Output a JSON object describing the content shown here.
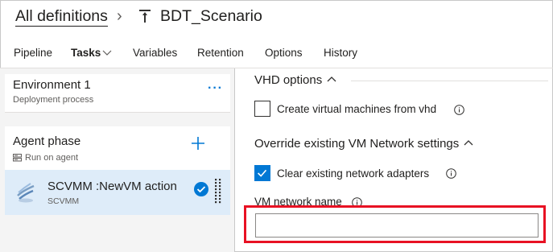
{
  "header": {
    "breadcrumb_link": "All definitions",
    "breadcrumb_separator": "›",
    "definition_icon": "rocket-pipeline-icon",
    "definition_name": "BDT_Scenario"
  },
  "tabs": [
    {
      "label": "Pipeline"
    },
    {
      "label": "Tasks",
      "active": true
    },
    {
      "label": "Variables"
    },
    {
      "label": "Retention"
    },
    {
      "label": "Options"
    },
    {
      "label": "History"
    }
  ],
  "left_pane": {
    "environment": {
      "title": "Environment 1",
      "subtitle": "Deployment process",
      "more": "···"
    },
    "phase": {
      "title": "Agent phase",
      "subtitle": "Run on agent",
      "add_icon": "plus-icon"
    },
    "task": {
      "title": "SCVMM :NewVM action",
      "subtitle": "SCVMM",
      "icon": "scvmm-icon"
    }
  },
  "right_pane": {
    "vhd_section": {
      "title": "VHD options"
    },
    "vhd_checkbox": {
      "label": "Create virtual machines from vhd",
      "checked": false
    },
    "network_section": {
      "title": "Override existing VM Network settings"
    },
    "network_checkbox": {
      "label": "Clear existing network adapters",
      "checked": true
    },
    "vm_network_name": {
      "label": "VM network name",
      "value": ""
    }
  },
  "colors": {
    "accent": "#0078d4",
    "selected_task_bg": "#deecf9",
    "highlight_border": "#e81123",
    "pane_bg": "#f4f4f4"
  }
}
